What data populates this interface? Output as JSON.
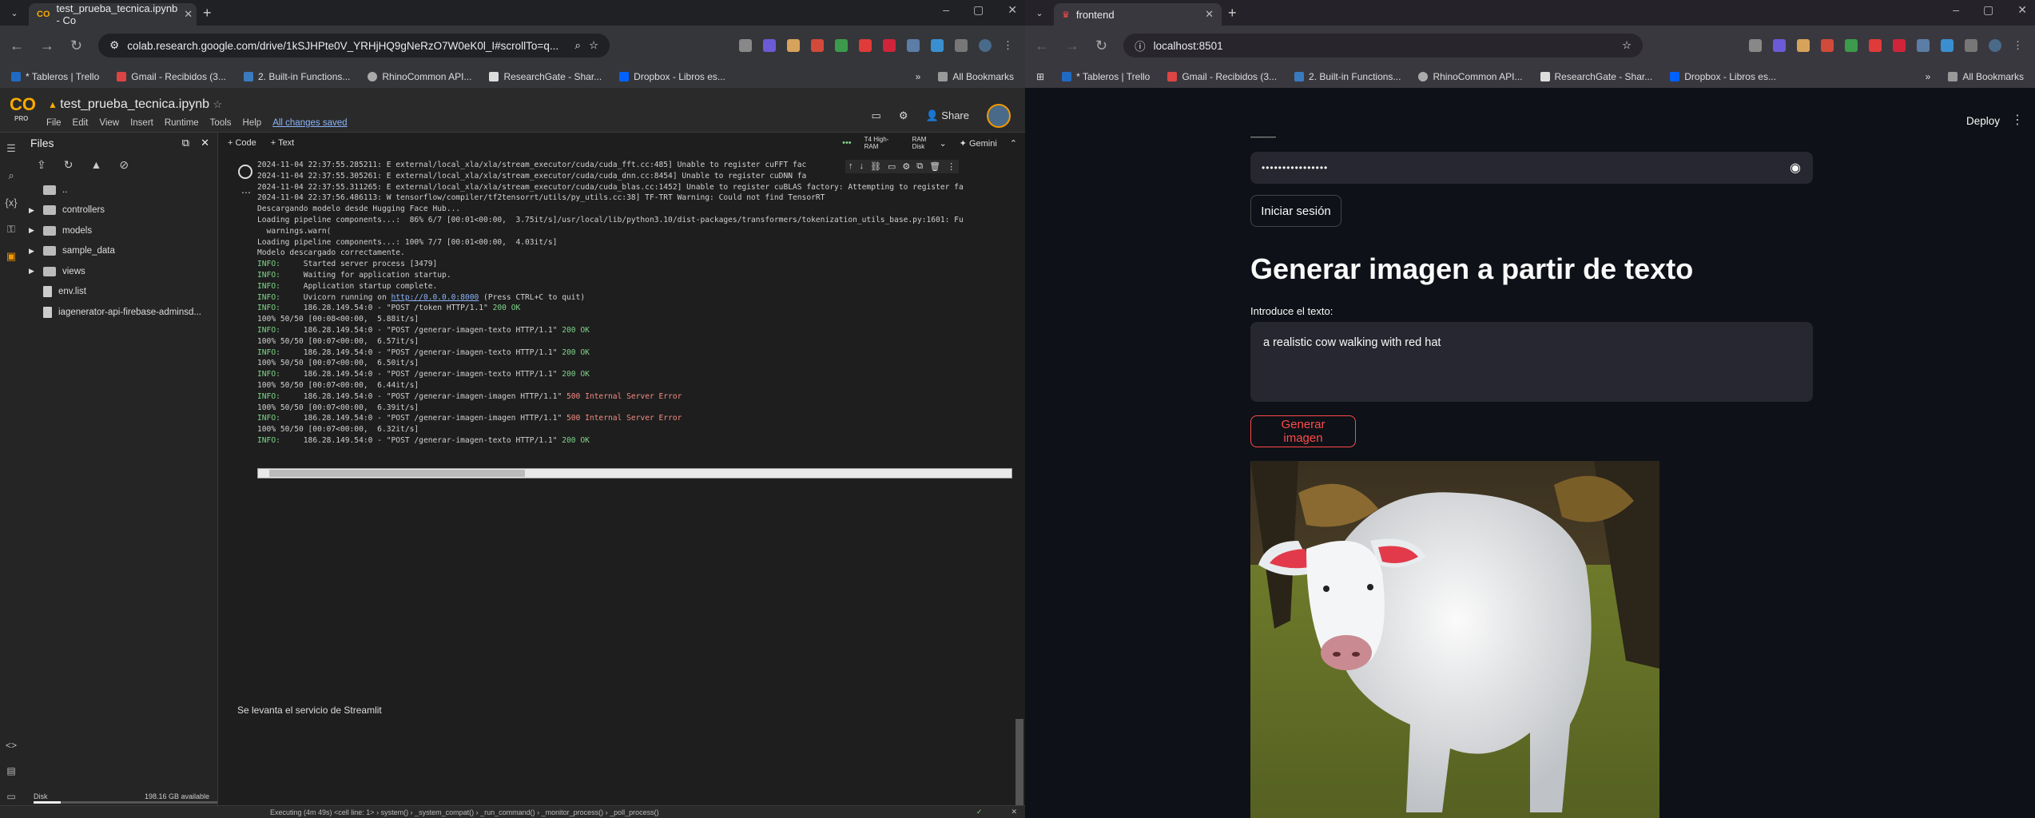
{
  "left": {
    "tab": {
      "title": "test_prueba_tecnica.ipynb - Co"
    },
    "url": "colab.research.google.com/drive/1kSJHPte0V_YRHjHQ9gNeRzO7W0eK0l_I#scrollTo=q...",
    "bookmarks": [
      "* Tableros | Trello",
      "Gmail - Recibidos (3...",
      "2. Built-in Functions...",
      "RhinoCommon API...",
      "ResearchGate - Shar...",
      "Dropbox - Libros es..."
    ],
    "all_bookmarks": "All Bookmarks",
    "colab": {
      "logo_text": "CO",
      "pro": "PRO",
      "notebook": "test_prueba_tecnica.ipynb",
      "menu": [
        "File",
        "Edit",
        "View",
        "Insert",
        "Runtime",
        "Tools",
        "Help"
      ],
      "saved": "All changes saved",
      "share": "Share",
      "files_title": "Files",
      "tree": [
        {
          "name": "..",
          "type": "folder"
        },
        {
          "name": "controllers",
          "type": "folder"
        },
        {
          "name": "models",
          "type": "folder"
        },
        {
          "name": "sample_data",
          "type": "folder"
        },
        {
          "name": "views",
          "type": "folder"
        },
        {
          "name": "env.list",
          "type": "file"
        },
        {
          "name": "iagenerator-api-firebase-adminsd...",
          "type": "file"
        }
      ],
      "disk_label": "Disk",
      "disk_avail": "198.16 GB available",
      "add_code": "+ Code",
      "add_text": "+ Text",
      "runtime": "T4 High-RAM",
      "ram": "RAM",
      "disk": "Disk",
      "gemini": "Gemini",
      "output_lines": [
        "2024-11-04 22:37:55.285211: E external/local_xla/xla/stream_executor/cuda/cuda_fft.cc:485] Unable to register cuFFT fac",
        "2024-11-04 22:37:55.305261: E external/local_xla/xla/stream_executor/cuda/cuda_dnn.cc:8454] Unable to register cuDNN fa",
        "2024-11-04 22:37:55.311265: E external/local_xla/xla/stream_executor/cuda/cuda_blas.cc:1452] Unable to register cuBLAS factory: Attempting to register fa",
        "2024-11-04 22:37:56.486113: W tensorflow/compiler/tf2tensorrt/utils/py_utils.cc:38] TF-TRT Warning: Could not find TensorRT",
        "Descargando modelo desde Hugging Face Hub...",
        "Loading pipeline components...:  86% 6/7 [00:01<00:00,  3.75it/s]/usr/local/lib/python3.10/dist-packages/transformers/tokenization_utils_base.py:1601: Fu",
        "  warnings.warn(",
        "Loading pipeline components...: 100% 7/7 [00:01<00:00,  4.03it/s]",
        "Modelo descargado correctamente."
      ],
      "server_lines": [
        {
          "k": "INFO:",
          "t": "     Started server process [3479]"
        },
        {
          "k": "INFO:",
          "t": "     Waiting for application startup."
        },
        {
          "k": "INFO:",
          "t": "     Application startup complete."
        },
        {
          "k": "INFO:",
          "t": "     Uvicorn running on ",
          "link": "http://0.0.0.0:8000",
          "t2": " (Press CTRL+C to quit)"
        },
        {
          "k": "INFO:",
          "t": "     186.28.149.54:0 - \"POST /token HTTP/1.1\" ",
          "s": "200 OK",
          "ok": true
        },
        {
          "p": "100% 50/50 [00:08<00:00,  5.88it/s]"
        },
        {
          "k": "INFO:",
          "t": "     186.28.149.54:0 - \"POST /generar-imagen-texto HTTP/1.1\" ",
          "s": "200 OK",
          "ok": true
        },
        {
          "p": "100% 50/50 [00:07<00:00,  6.57it/s]"
        },
        {
          "k": "INFO:",
          "t": "     186.28.149.54:0 - \"POST /generar-imagen-texto HTTP/1.1\" ",
          "s": "200 OK",
          "ok": true
        },
        {
          "p": "100% 50/50 [00:07<00:00,  6.50it/s]"
        },
        {
          "k": "INFO:",
          "t": "     186.28.149.54:0 - \"POST /generar-imagen-texto HTTP/1.1\" ",
          "s": "200 OK",
          "ok": true
        },
        {
          "p": "100% 50/50 [00:07<00:00,  6.44it/s]"
        },
        {
          "k": "INFO:",
          "t": "     186.28.149.54:0 - \"POST /generar-imagen-imagen HTTP/1.1\" ",
          "s": "500 Internal Server Error",
          "ok": false
        },
        {
          "p": "100% 50/50 [00:07<00:00,  6.39it/s]"
        },
        {
          "k": "INFO:",
          "t": "     186.28.149.54:0 - \"POST /generar-imagen-imagen HTTP/1.1\" ",
          "s": "500 Internal Server Error",
          "ok": false
        },
        {
          "p": "100% 50/50 [00:07<00:00,  6.32it/s]"
        },
        {
          "k": "INFO:",
          "t": "     186.28.149.54:0 - \"POST /generar-imagen-texto HTTP/1.1\" ",
          "s": "200 OK",
          "ok": true
        }
      ],
      "text_cell": "Se levanta el servicio de Streamlit",
      "status": "Executing (4m 49s)  <cell line: 1> › system() › _system_compat() › _run_command() › _monitor_process() › _poll_process()"
    }
  },
  "right": {
    "tab": {
      "title": "frontend"
    },
    "url": "localhost:8501",
    "bookmarks": [
      "* Tableros | Trello",
      "Gmail - Recibidos (3...",
      "2. Built-in Functions...",
      "RhinoCommon API...",
      "ResearchGate - Shar...",
      "Dropbox - Libros es..."
    ],
    "all_bookmarks": "All Bookmarks",
    "app": {
      "deploy": "Deploy",
      "password_mask": "••••••••••••••••",
      "login_button": "Iniciar sesión",
      "title": "Generar imagen a partir de texto",
      "input_label": "Introduce el texto:",
      "input_value": "a realistic cow walking with red hat",
      "generate_button": "Generar imagen"
    }
  }
}
